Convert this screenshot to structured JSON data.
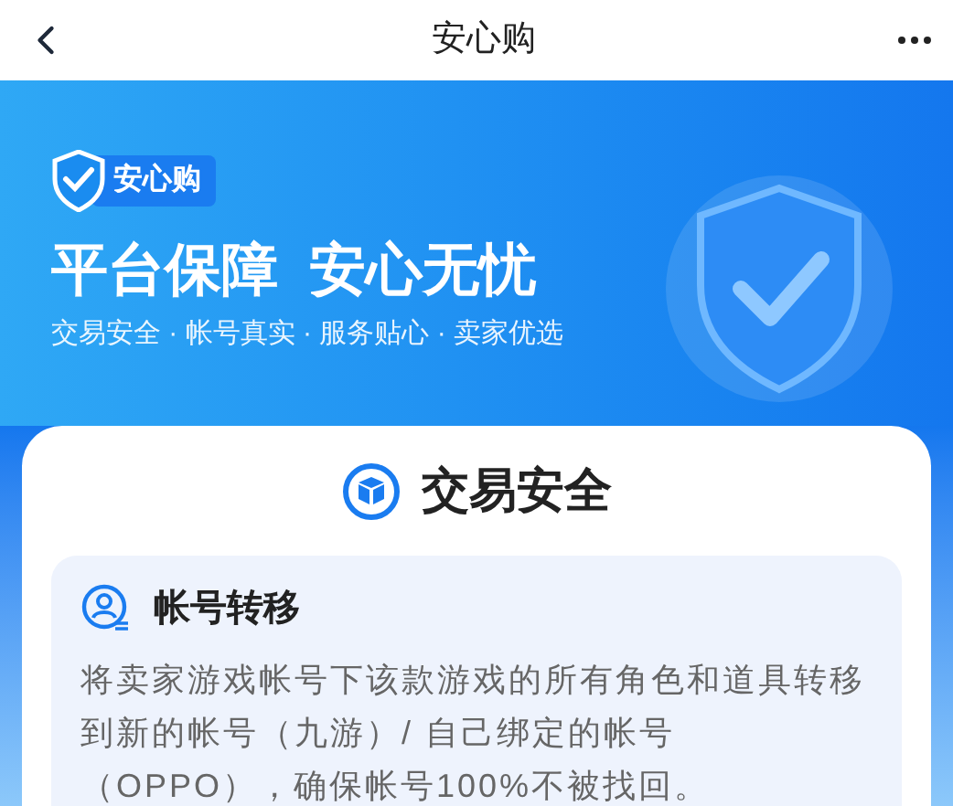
{
  "header": {
    "title": "安心购"
  },
  "banner": {
    "badge": "安心购",
    "headline": "平台保障  安心无忧",
    "tagline": "交易安全 · 帐号真实 · 服务贴心 · 卖家优选"
  },
  "section": {
    "title": "交易安全",
    "items": [
      {
        "title": "帐号转移",
        "description": "将卖家游戏帐号下该款游戏的所有角色和道具转移到新的帐号（九游）/ 自己绑定的帐号（OPPO），确保帐号100%不被找回。"
      }
    ]
  }
}
